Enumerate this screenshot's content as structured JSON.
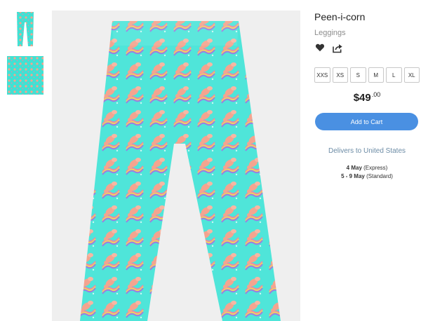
{
  "product": {
    "title": "Peen-i-corn",
    "category": "Leggings",
    "price_main": "$49",
    "price_cents": ".00",
    "add_to_cart": "Add to Cart",
    "sizes": [
      "XXS",
      "XS",
      "S",
      "M",
      "L",
      "XL"
    ]
  },
  "delivery": {
    "heading": "Delivers to United States",
    "options": [
      {
        "date": "4 May",
        "method": " (Express)"
      },
      {
        "date": "5 - 9 May",
        "method": " (Standard)"
      }
    ]
  },
  "icons": {
    "wishlist": "heart-icon",
    "share": "share-icon"
  },
  "colors": {
    "accent": "#4a90e2",
    "pattern_base": "#3ee3d6",
    "pattern_peach": "#f3a898",
    "background_stage": "#efefef"
  }
}
